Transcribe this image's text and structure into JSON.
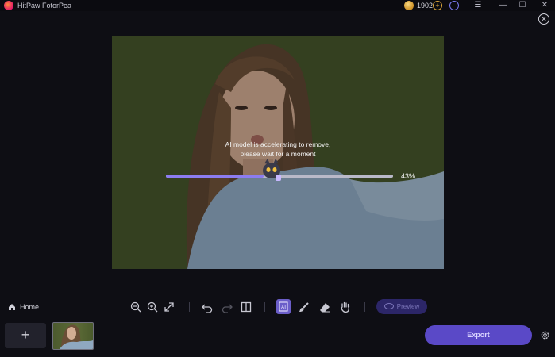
{
  "app": {
    "title": "HitPaw FotorPea"
  },
  "header": {
    "coins": "1902",
    "coin_add_symbol": "+",
    "window_controls": [
      "☰",
      "—",
      "☐",
      "✕"
    ]
  },
  "canvas": {
    "status_line1": "AI model is accelerating to remove,",
    "status_line2": "please wait for a moment",
    "progress": 0.43,
    "progress_label": "43%"
  },
  "toolbar": {
    "home_label": "Home",
    "preview_label": "Preview"
  },
  "bottom": {
    "add_symbol": "+",
    "export_label": "Export"
  },
  "colors": {
    "accent": "#5a49c7",
    "progress_fill": "#8c7cf0",
    "background": "#0e0e14"
  },
  "icons": [
    "app-logo-icon",
    "coin-icon",
    "user-icon",
    "close-icon",
    "home-icon",
    "zoom-out-icon",
    "zoom-in-icon",
    "fit-screen-icon",
    "undo-icon",
    "redo-icon",
    "compare-icon",
    "ai-select-icon",
    "brush-icon",
    "eraser-icon",
    "hand-icon",
    "eye-icon",
    "settings-icon"
  ]
}
